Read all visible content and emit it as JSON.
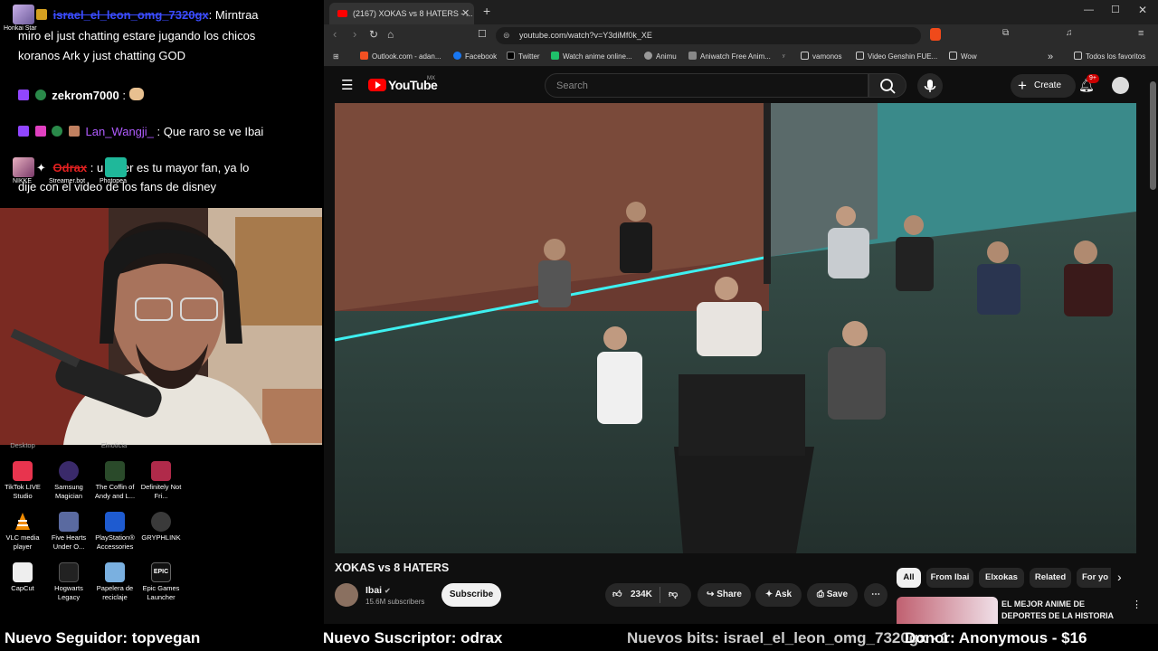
{
  "chat": {
    "messages": [
      {
        "user": "israel_el_leon_omg_7320gx",
        "text": ": Mirntraa"
      },
      {
        "text": "miro el just chatting estare jugando los chicos"
      },
      {
        "text": "koranos Ark y just chatting GOD"
      },
      {
        "user": "zekrom7000",
        "text": " :"
      },
      {
        "user": "Lan_Wangji_",
        "text": " : Que raro se ve Ibai"
      },
      {
        "user": "Odrax",
        "text": " : u hater es tu mayor fan, ya lo"
      },
      {
        "text": "dije con el video de los fans de disney"
      }
    ],
    "overlay_icons": [
      {
        "label": "Honkai Star"
      },
      {
        "label": "NIKKE"
      },
      {
        "label": "Streamer.bot"
      },
      {
        "label": "Photopea"
      }
    ]
  },
  "desktop": {
    "partial_labels": [
      "Desktop",
      "Elnoticia"
    ],
    "icons": [
      {
        "label": "TikTok LIVE Studio",
        "color": "#e8344e"
      },
      {
        "label": "Samsung Magician",
        "color": "#3a2a6a"
      },
      {
        "label": "The Coffin of Andy and L...",
        "color": "#2a4a2a"
      },
      {
        "label": "Definitely Not Fri...",
        "color": "#b02a4a"
      },
      {
        "label": "VLC media player",
        "color": "#f08a00"
      },
      {
        "label": "Five Hearts Under O...",
        "color": "#5a6aa0"
      },
      {
        "label": "PlayStation® Accessories",
        "color": "#1e5bd0"
      },
      {
        "label": "GRYPHLINK",
        "color": "#3a3a3a"
      },
      {
        "label": "CapCut",
        "color": "#eeeeee"
      },
      {
        "label": "Hogwarts Legacy",
        "color": "#222222"
      },
      {
        "label": "Papelera de reciclaje",
        "color": "#7ab0e0"
      },
      {
        "label": "Epic Games Launcher",
        "color": "#111111"
      }
    ]
  },
  "browser": {
    "tab_title": "(2167) XOKAS vs 8 HATERS - ...",
    "new_tab": "+",
    "url": "youtube.com/watch?v=Y3diMf0k_XE",
    "bookmarks": [
      "Outlook.com - adan...",
      "Facebook",
      "Twitter",
      "Watch anime online...",
      "Animu",
      "Aniwatch Free Anim...",
      "vamonos",
      "Video Genshin FUE...",
      "Wow"
    ],
    "all_bookmarks": "Todos los favoritos",
    "bookmarks_overflow": "»"
  },
  "youtube": {
    "logo": "YouTube",
    "region": "MX",
    "search_placeholder": "Search",
    "create": "Create",
    "notifications": "9+",
    "video_title": "XOKAS vs 8 HATERS",
    "channel": "Ibai",
    "subscribers": "15.6M subscribers",
    "subscribe": "Subscribe",
    "likes": "234K",
    "share": "Share",
    "ask": "Ask",
    "save": "Save",
    "chips": [
      "All",
      "From Ibai",
      "Elxokas",
      "Related",
      "For yo"
    ],
    "rec_title_1": "EL MEJOR ANIME DE",
    "rec_title_2": "DEPORTES DE LA HISTORIA"
  },
  "ticker": {
    "follower": "Nuevo Seguidor: topvegan",
    "subscriber": "Nuevo Suscriptor: odrax",
    "bits": "Nuevos bits: israel_el_leon_omg_7320gx - 1",
    "donor": "Donor: Anonymous - $16"
  },
  "colors": {
    "accent_red": "#ff0000",
    "chat_blue_user": "#3b4cff",
    "chat_purple_user": "#b05cff"
  }
}
